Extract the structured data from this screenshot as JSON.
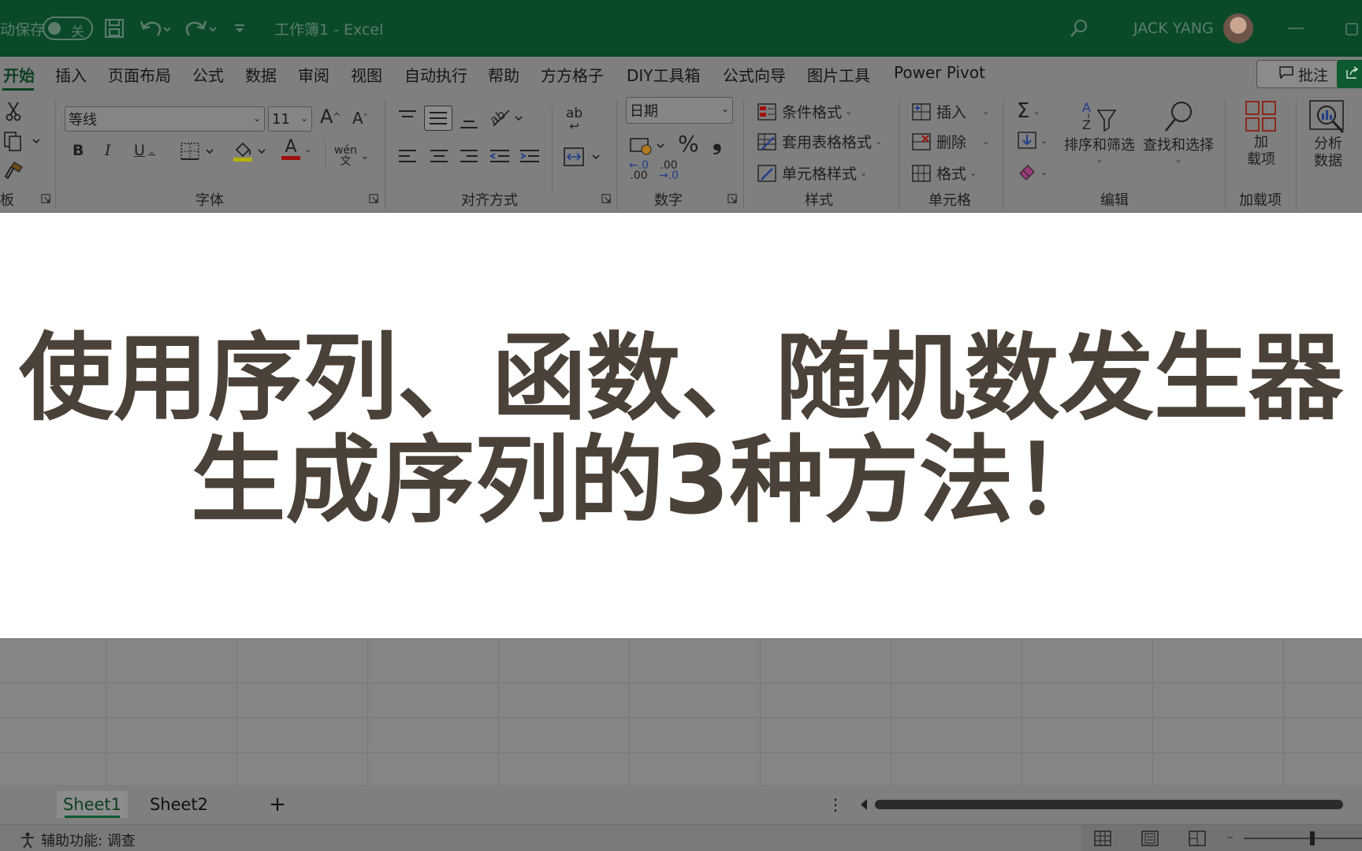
{
  "titlebar": {
    "autosave_label": "动保存",
    "autosave_state": "关",
    "document_title": "工作簿1  -  Excel",
    "user_name": "JACK YANG"
  },
  "menu": {
    "tabs": [
      "开始",
      "插入",
      "页面布局",
      "公式",
      "数据",
      "审阅",
      "视图",
      "自动执行",
      "帮助",
      "方方格子",
      "DIY工具箱",
      "公式向导",
      "图片工具",
      "Power Pivot"
    ],
    "active_tab": "开始",
    "comment_button": "批注"
  },
  "ribbon": {
    "clipboard_label": "板",
    "font": {
      "group_label": "字体",
      "font_name": "等线",
      "font_size": "11",
      "grow": "A",
      "shrink": "A",
      "bold": "B",
      "italic": "I",
      "underline": "U",
      "font_color_glyph": "A",
      "phonetic": "wén\n文"
    },
    "alignment": {
      "group_label": "对齐方式",
      "wrap_glyph": "ab"
    },
    "number": {
      "group_label": "数字",
      "format": "日期",
      "percent": "%",
      "comma": "❟",
      "inc_decimal": ".00",
      "dec_decimal": ".00"
    },
    "styles": {
      "group_label": "样式",
      "conditional": "条件格式",
      "table_format": "套用表格格式",
      "cell_styles": "单元格样式"
    },
    "cells": {
      "group_label": "单元格",
      "insert": "插入",
      "delete": "删除",
      "format": "格式"
    },
    "editing": {
      "group_label": "编辑",
      "sort_filter": "排序和筛选",
      "find_select": "查找和选择"
    },
    "addins": {
      "group_label": "加载项",
      "addin_line1": "加",
      "addin_line2": "载项",
      "analyze_line1": "分析",
      "analyze_line2": "数据"
    }
  },
  "overlay": {
    "line1": "使用序列、函数、随机数发生器",
    "line2": "生成序列的3种方法！"
  },
  "sheets": {
    "tabs": [
      "Sheet1",
      "Sheet2"
    ],
    "active": "Sheet1",
    "add": "+"
  },
  "status": {
    "accessibility": "辅助功能: 调查"
  },
  "colors": {
    "titlebar_bg": "#0a4a28",
    "headline_text": "#4a4238",
    "accent_green": "#0d5a2e"
  }
}
